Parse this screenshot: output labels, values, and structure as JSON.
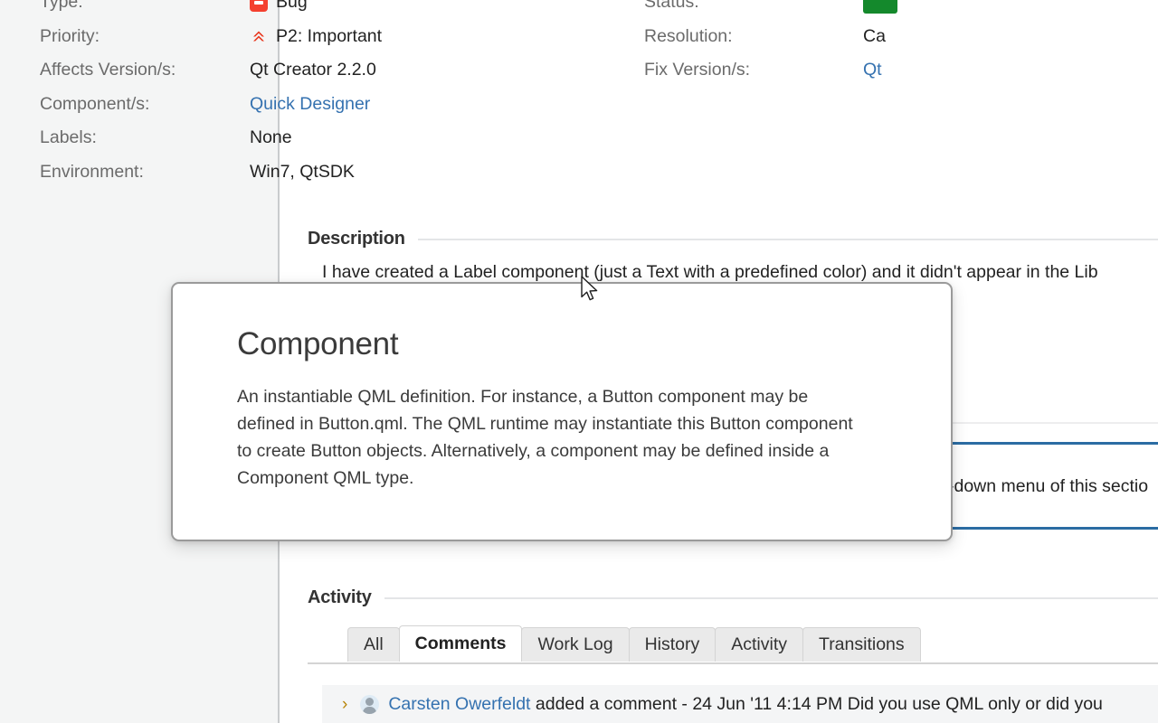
{
  "issue": {
    "fields_left": [
      {
        "label": "Type:",
        "value": "Bug",
        "icon": "bug-icon",
        "style": "plain"
      },
      {
        "label": "Priority:",
        "value": "P2: Important",
        "icon": "priority-major-icon",
        "style": "plain"
      },
      {
        "label": "Affects Version/s:",
        "value": "Qt Creator 2.2.0",
        "icon": "",
        "style": "plain"
      },
      {
        "label": "Component/s:",
        "value": "Quick Designer",
        "icon": "",
        "style": "link"
      },
      {
        "label": "Labels:",
        "value": "None",
        "icon": "",
        "style": "plain"
      },
      {
        "label": "Environment:",
        "value": "Win7, QtSDK",
        "icon": "",
        "style": "plain"
      }
    ],
    "fields_right": [
      {
        "label": "Status:",
        "value": "",
        "icon": "status-lozenge",
        "style": "lozenge"
      },
      {
        "label": "Resolution:",
        "value": "Ca",
        "icon": "",
        "style": "plain"
      },
      {
        "label": "Fix Version/s:",
        "value": "Qt",
        "icon": "",
        "style": "link"
      }
    ]
  },
  "description": {
    "heading": "Description",
    "text_before": "I have created a Label ",
    "glossary_term": "component",
    "text_after": " (just a Text with a predefined color) and it didn't appear in the Lib"
  },
  "occluded": {
    "line_fragment": "-down menu of this sectio"
  },
  "popup": {
    "title": "Component",
    "body": "An instantiable QML definition. For instance, a Button component may be defined in Button.qml. The QML runtime may instantiate this Button component to create Button objects. Alternatively, a component may be defined inside a Component QML type."
  },
  "activity": {
    "heading": "Activity",
    "tabs": [
      {
        "label": "All",
        "active": false
      },
      {
        "label": "Comments",
        "active": true
      },
      {
        "label": "Work Log",
        "active": false
      },
      {
        "label": "History",
        "active": false
      },
      {
        "label": "Activity",
        "active": false
      },
      {
        "label": "Transitions",
        "active": false
      }
    ],
    "comment": {
      "author": "Carsten Owerfeldt",
      "action": " added a comment - ",
      "timestamp": "24 Jun '11 4:14 PM",
      "body_fragment": " Did you use QML only or did you"
    }
  },
  "colors": {
    "link": "#3572b0",
    "bug_red": "#f4402f",
    "priority_red": "#e8361d",
    "status_green": "#14892c",
    "glossary_underline": "#2e8b3c",
    "rule_blue": "#2b6ca3"
  }
}
